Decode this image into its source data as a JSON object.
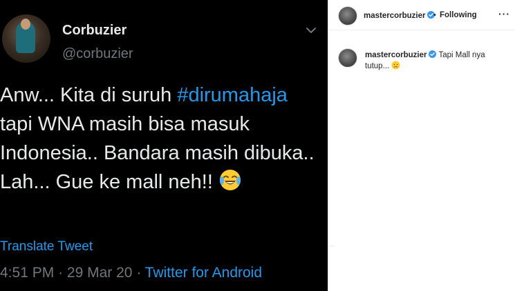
{
  "tweet": {
    "name": "Corbuzier",
    "handle": "@corbuzier",
    "text_before": "Anw... Kita di suruh ",
    "hashtag": "#dirumahaja",
    "text_after": " tapi WNA masih bisa masuk Indonesia.. Bandara masih dibuka.. Lah... Gue ke mall neh!! ",
    "translate_label": "Translate Tweet",
    "time": "4:51 PM",
    "date": "29 Mar 20",
    "separator": "·",
    "source": "Twitter for Android",
    "emoji": "face-with-tears-of-joy"
  },
  "instagram": {
    "username": "mastercorbuzier",
    "follow_separator": "•",
    "follow_label": "Following",
    "more_label": "···",
    "caption_username": "mastercorbuzier",
    "caption_text": "Tapi Mall nya tutup...",
    "caption_emoji": "disappointed-face"
  },
  "colors": {
    "twitter_bg": "#000000",
    "twitter_text": "#e7e9ea",
    "twitter_secondary": "#71767b",
    "twitter_accent": "#1d9bf0",
    "instagram_bg": "#ffffff",
    "instagram_text": "#262626",
    "verified_badge": "#3897f0"
  }
}
